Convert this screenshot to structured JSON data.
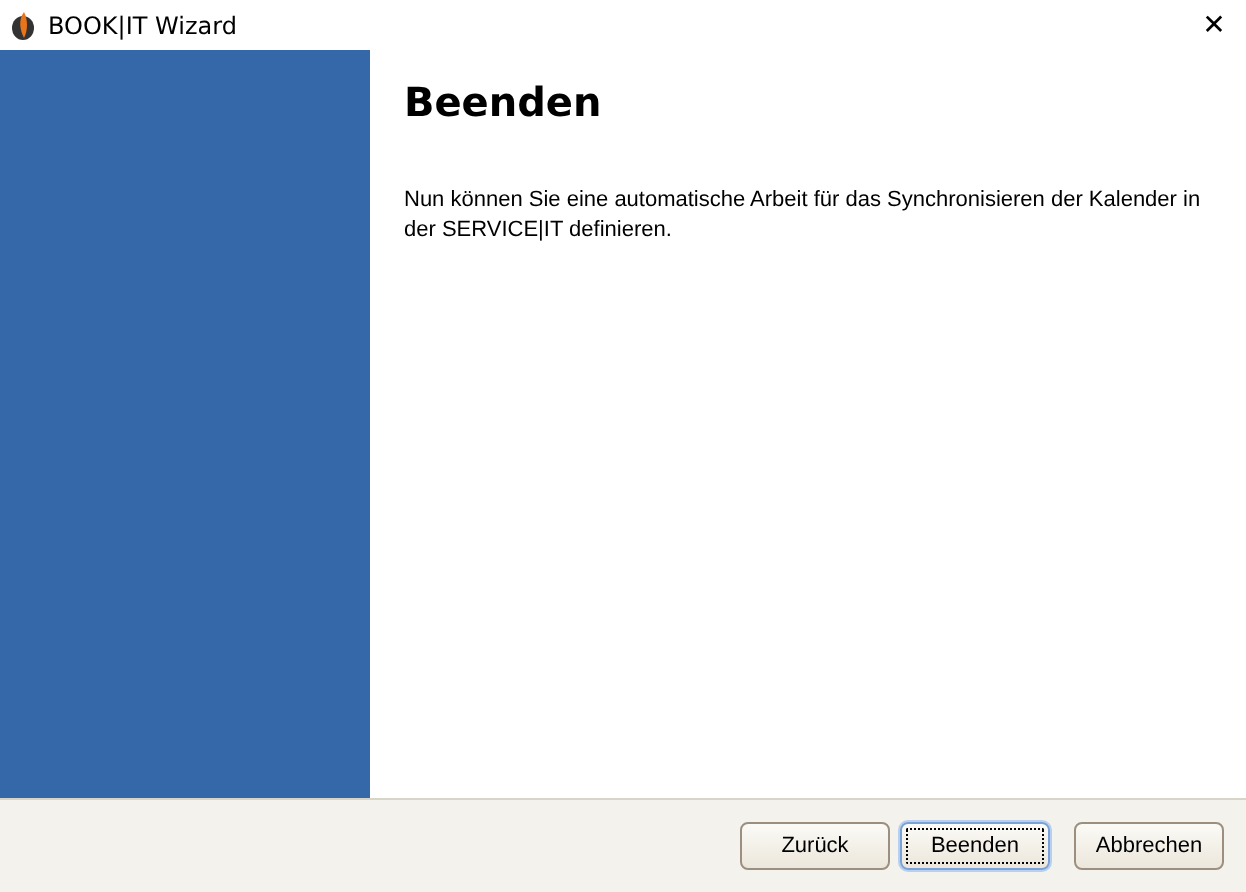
{
  "window": {
    "title": "BOOK|IT Wizard",
    "close": "✕"
  },
  "page": {
    "heading": "Beenden",
    "text": "Nun können Sie eine automatische Arbeit für das Synchronisieren der Kalender in der SERVICE|IT definieren."
  },
  "buttons": [
    {
      "label": "Zurück",
      "focused": false
    },
    {
      "label": "Beenden",
      "focused": true
    },
    {
      "label": "Abbrechen",
      "focused": false
    }
  ]
}
